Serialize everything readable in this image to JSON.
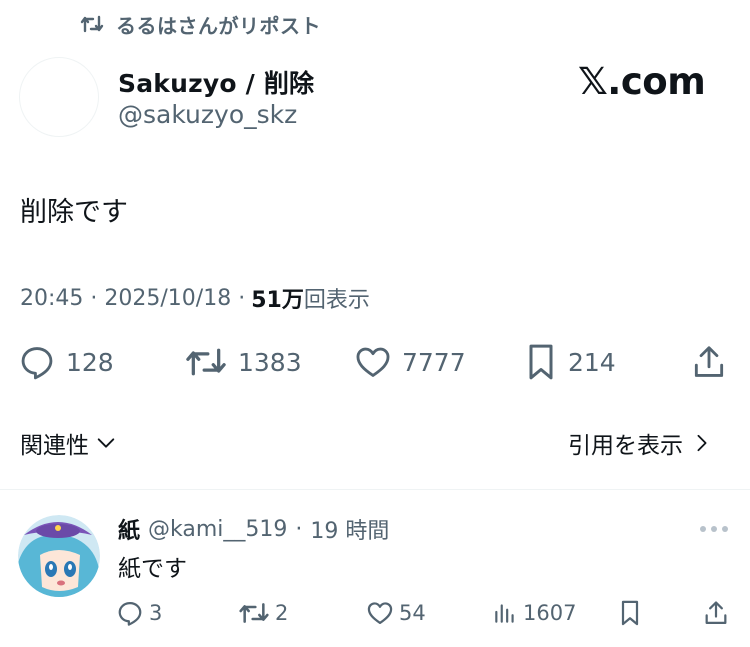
{
  "repost": {
    "text": "るるはさんがリポスト",
    "icon": "repost-icon"
  },
  "author": {
    "name": "Sakuzyo / 削除",
    "handle": "@sakuzyo_skz"
  },
  "brand": "𝕏.com",
  "tweet": {
    "text": "削除です",
    "time": "20:45",
    "date": "2025/10/18",
    "views_count": "51万",
    "views_label": "回表示"
  },
  "stats": {
    "replies": "128",
    "reposts": "1383",
    "likes": "7777",
    "bookmarks": "214"
  },
  "links": {
    "related": "関連性",
    "quotes": "引用を表示"
  },
  "reply": {
    "name": "紙",
    "handle": "@kami__519",
    "time": "19 時間",
    "text": "紙です",
    "stats": {
      "replies": "3",
      "reposts": "2",
      "likes": "54",
      "views": "1607"
    }
  },
  "colors": {
    "text": "#0f1419",
    "muted": "#536471",
    "divider": "#eff3f4"
  }
}
